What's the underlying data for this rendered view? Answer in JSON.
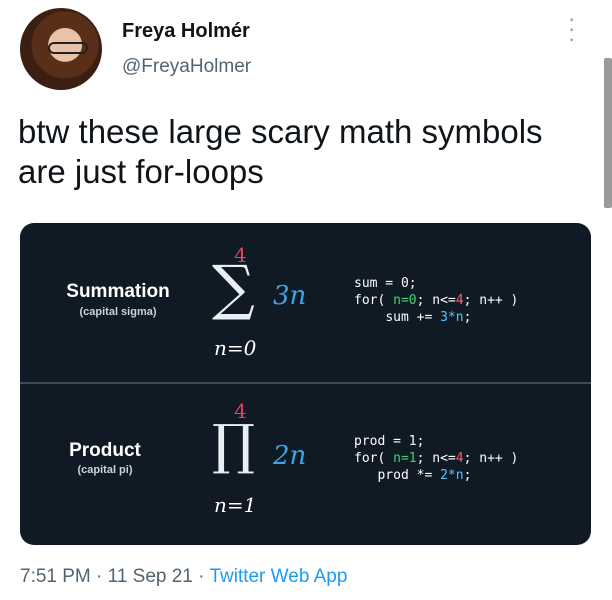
{
  "author": {
    "name": "Freya Holmér",
    "handle": "@FreyaHolmer"
  },
  "tweet": {
    "text": "btw these large scary math symbols are just for-loops"
  },
  "card": {
    "summation": {
      "title": "Summation",
      "subtitle": "(capital sigma)",
      "symbol": "∑",
      "upper": "4",
      "lower": "n=0",
      "term": "3n",
      "code": {
        "line1": "sum = 0;",
        "line2_a": "for( ",
        "line2_init": "n=0",
        "line2_b": "; n<=",
        "line2_lim": "4",
        "line2_c": "; n++ )",
        "line3_a": "sum += ",
        "line3_expr": "3*n",
        "line3_b": ";"
      }
    },
    "product": {
      "title": "Product",
      "subtitle": "(capital pi)",
      "symbol": "∏",
      "upper": "4",
      "lower": "n=1",
      "term": "2n",
      "code": {
        "line1": "prod = 1;",
        "line2_a": "for( ",
        "line2_init": "n=1",
        "line2_b": "; n<=",
        "line2_lim": "4",
        "line2_c": "; n++ )",
        "line3_a": "prod *= ",
        "line3_expr": "2*n",
        "line3_b": ";"
      }
    }
  },
  "footer": {
    "time": "7:51 PM",
    "sep1": " · ",
    "date": "11 Sep 21",
    "sep2": " · ",
    "app": "Twitter Web App"
  },
  "colors": {
    "card_bg": "#0f1a24",
    "accent_red": "#e8415a",
    "accent_blue": "#3fa3e8",
    "code_green": "#49d17a",
    "link": "#1d9bf0"
  }
}
